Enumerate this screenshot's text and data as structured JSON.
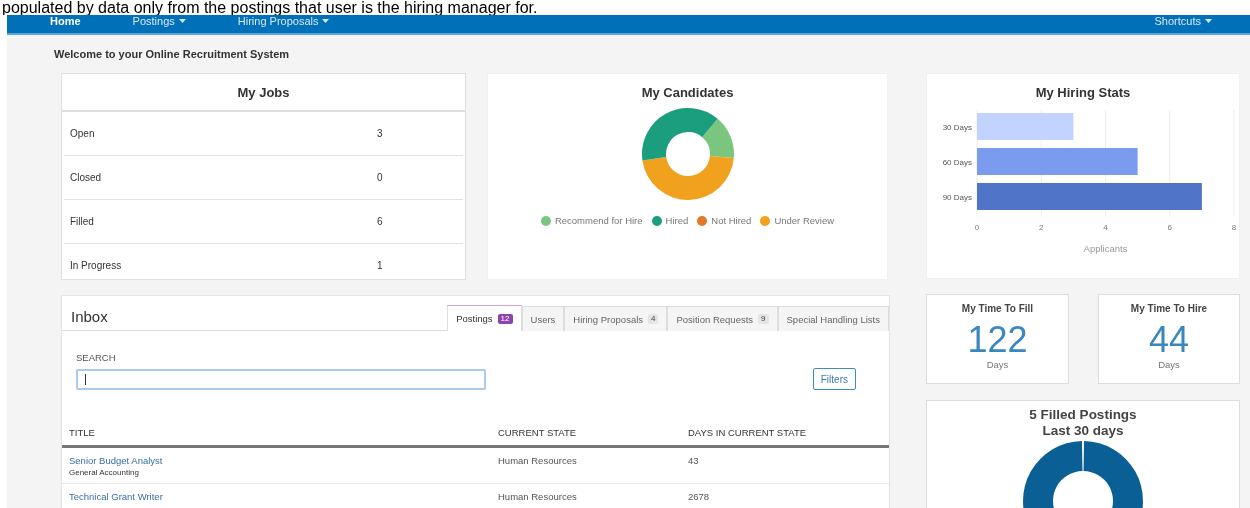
{
  "document_text": "populated by data only from the postings that user is the hiring manager for.",
  "nav": {
    "items": [
      {
        "label": "Home",
        "selected": true,
        "dropdown": false
      },
      {
        "label": "Postings",
        "selected": false,
        "dropdown": true
      },
      {
        "label": "Hiring Proposals",
        "selected": false,
        "dropdown": true
      }
    ],
    "right_items": [
      {
        "label": "Shortcuts",
        "selected": false,
        "dropdown": true
      }
    ]
  },
  "welcome": "Welcome to your Online Recruitment System",
  "my_jobs": {
    "title": "My Jobs",
    "rows": [
      {
        "label": "Open",
        "count": "3"
      },
      {
        "label": "Closed",
        "count": "0"
      },
      {
        "label": "Filled",
        "count": "6"
      },
      {
        "label": "In Progress",
        "count": "1"
      }
    ]
  },
  "my_candidates": {
    "title": "My Candidates",
    "legend": [
      {
        "label": "Recommend for Hire",
        "color": "#7bc67e"
      },
      {
        "label": "Hired",
        "color": "#1a9e7e"
      },
      {
        "label": "Not Hired",
        "color": "#e07a2a"
      },
      {
        "label": "Under Review",
        "color": "#f0a21e"
      }
    ]
  },
  "hiring_stats": {
    "title": "My Hiring Stats",
    "chart_data": {
      "type": "bar",
      "orientation": "horizontal",
      "xlabel": "Applicants",
      "categories": [
        "30 Days",
        "60 Days",
        "90 Days"
      ],
      "values": [
        3,
        5,
        7
      ],
      "xlim": [
        0,
        8
      ],
      "xticks": [
        0,
        2,
        4,
        6,
        8
      ],
      "grid": true
    }
  },
  "inbox": {
    "title": "Inbox",
    "tabs": [
      {
        "label": "Postings",
        "count": "12",
        "selected": true
      },
      {
        "label": "Users",
        "selected": false
      },
      {
        "label": "Hiring Proposals",
        "count": "4",
        "selected": false
      },
      {
        "label": "Position Requests",
        "count": "9",
        "selected": false
      },
      {
        "label": "Special Handling Lists",
        "selected": false
      }
    ],
    "search": {
      "label": "SEARCH",
      "focused": true
    },
    "filters_button": "Filters",
    "columns": [
      "TITLE",
      "CURRENT STATE",
      "DAYS IN CURRENT STATE"
    ],
    "rows": [
      {
        "title": "Senior Budget Analyst",
        "department": "General Accounting",
        "state": "Human Resources",
        "days": "43"
      },
      {
        "title": "Technical Grant Writer",
        "state": "Human Resources",
        "days": "2678"
      }
    ]
  },
  "metrics": [
    {
      "title": "My Time To Fill",
      "value": "122",
      "unit": "Days"
    },
    {
      "title": "My Time To Hire",
      "value": "44",
      "unit": "Days"
    }
  ],
  "filled_postings": {
    "title_lines": [
      "5 Filled Postings",
      "Last 30 days"
    ]
  }
}
